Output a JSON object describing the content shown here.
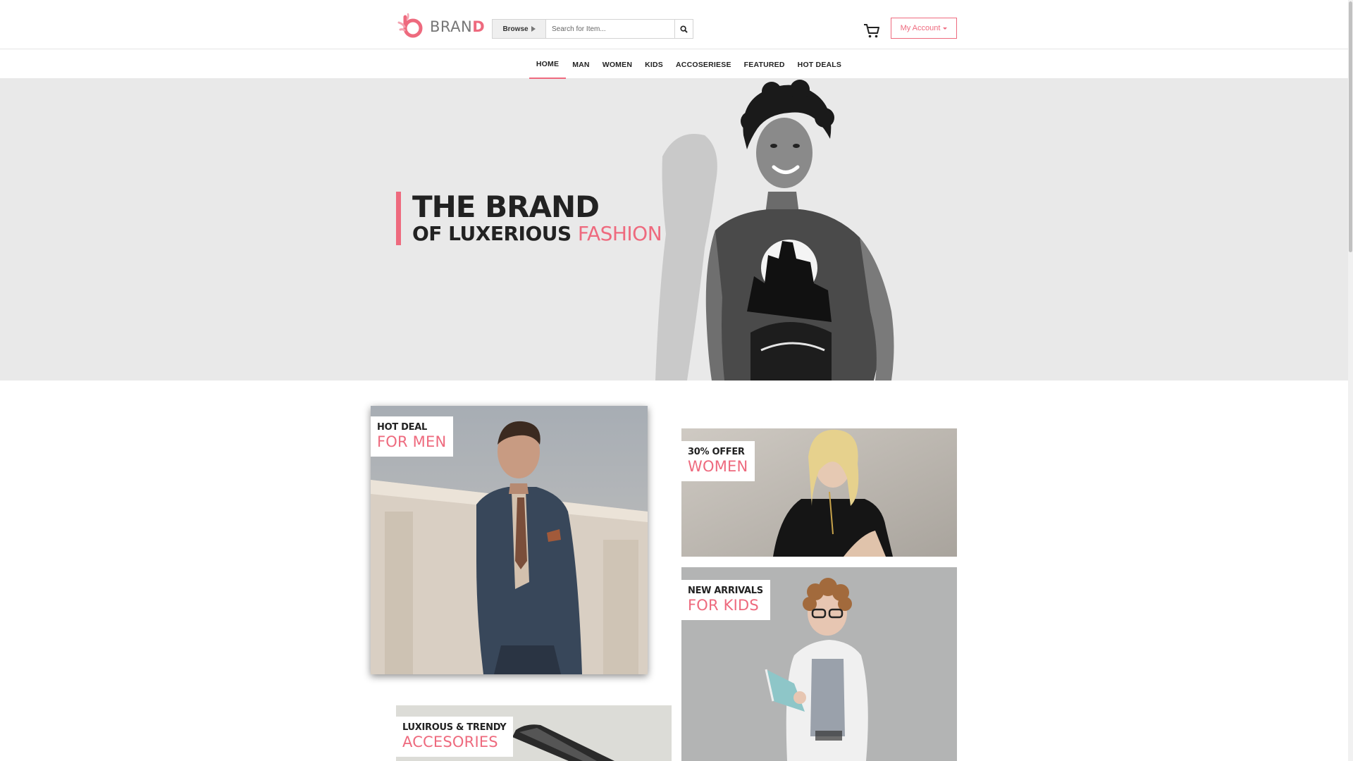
{
  "brand": {
    "name_main": "BRAN",
    "name_accent": "D"
  },
  "search": {
    "browse_label": "Browse",
    "placeholder": "Search for Item..."
  },
  "header": {
    "account_label": "My Account"
  },
  "nav": {
    "items": [
      {
        "label": "HOME",
        "active": true
      },
      {
        "label": "MAN"
      },
      {
        "label": "WOMEN"
      },
      {
        "label": "KIDS"
      },
      {
        "label": "ACCOSERIESE"
      },
      {
        "label": "FEATURED"
      },
      {
        "label": "HOT DEALS"
      }
    ]
  },
  "hero": {
    "line1": "THE BRAND",
    "line2_main": "OF LUXERIOUS",
    "line2_accent": "FASHION"
  },
  "promos": {
    "men": {
      "small": "HOT DEAL",
      "big": "FOR MEN"
    },
    "women": {
      "small": "30% OFFER",
      "big": "WOMEN"
    },
    "kids": {
      "small": "NEW ARRIVALS",
      "big": "FOR KIDS"
    },
    "accessories": {
      "small": "LUXIROUS & TRENDY",
      "big": "ACCESORIES"
    }
  },
  "colors": {
    "accent": "#ee6a7e",
    "hero_bg": "#e9e9e9"
  },
  "icons": [
    "brand-logo-icon",
    "browse-arrow-icon",
    "search-icon",
    "cart-icon",
    "dropdown-caret-icon"
  ]
}
